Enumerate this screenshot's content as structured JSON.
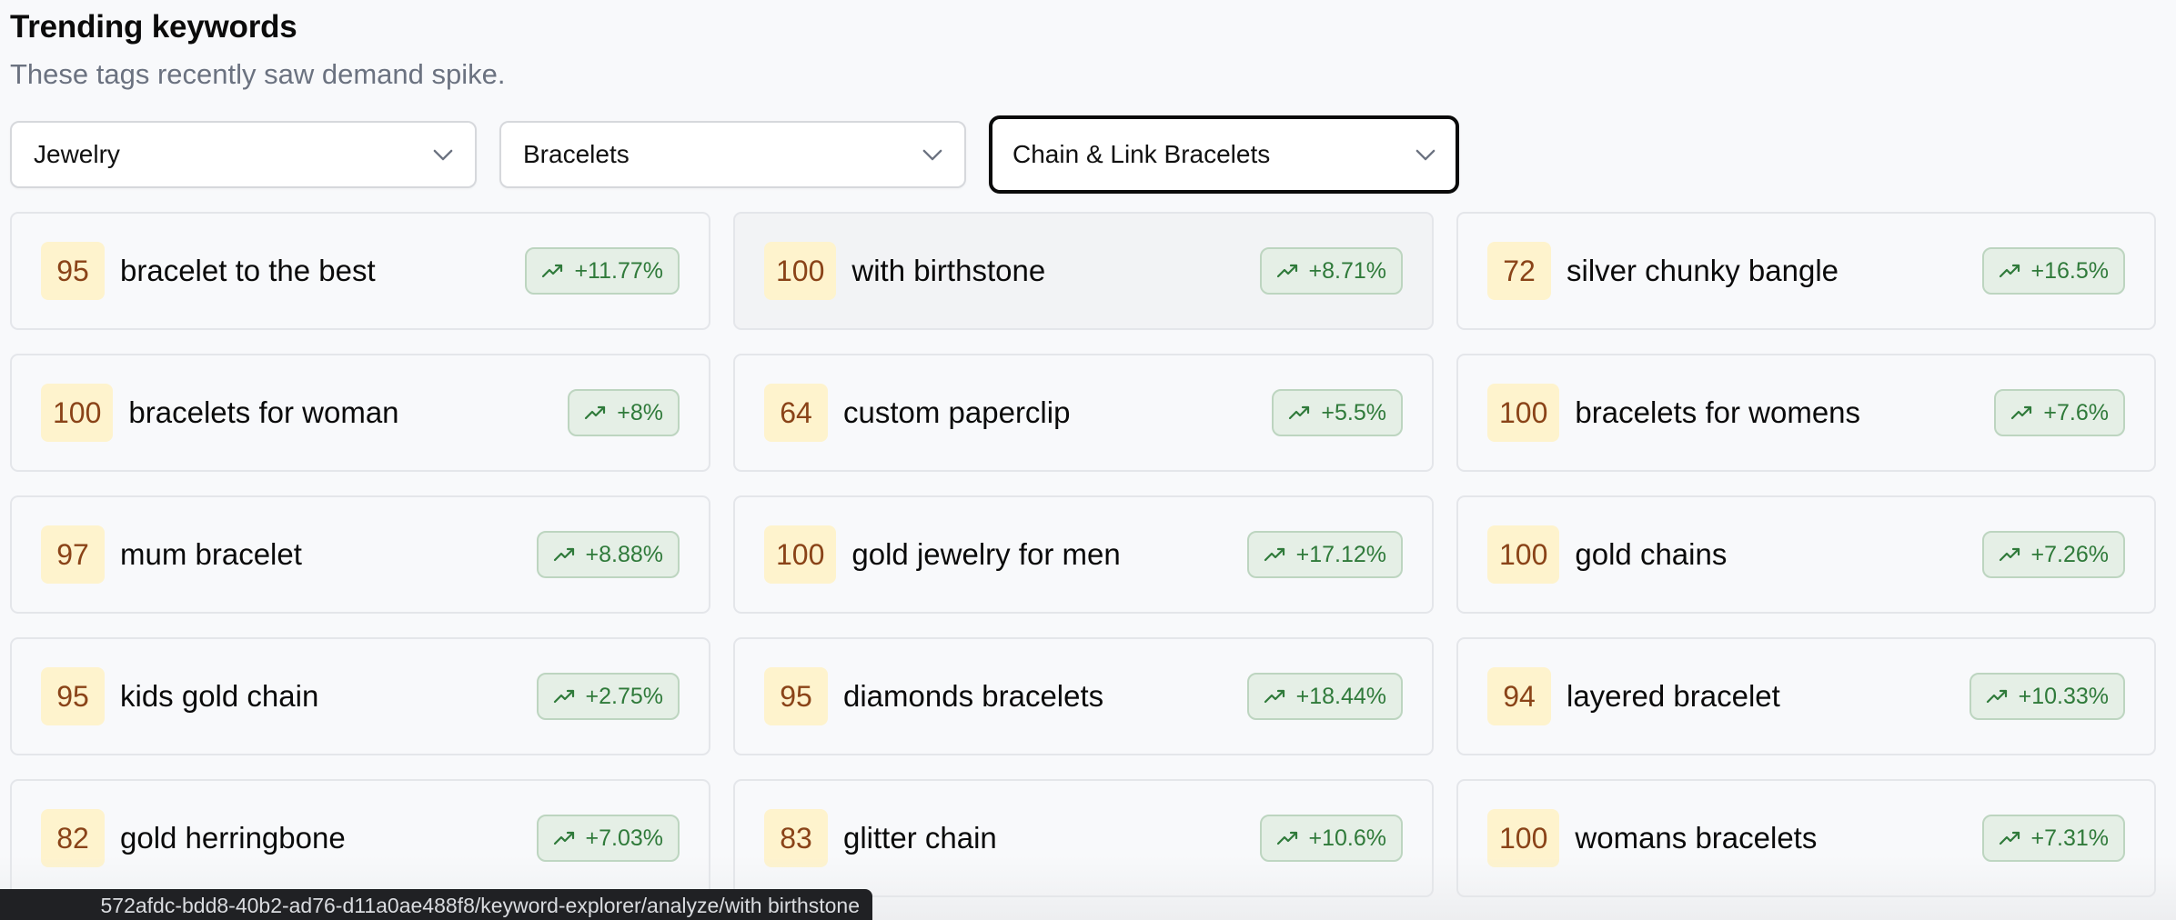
{
  "header": {
    "title": "Trending keywords",
    "subtitle": "These tags recently saw demand spike."
  },
  "filters": {
    "category": {
      "value": "Jewelry"
    },
    "subcategory": {
      "value": "Bracelets"
    },
    "type": {
      "value": "Chain & Link Bracelets",
      "focused": true
    }
  },
  "keywords": [
    {
      "score": "95",
      "keyword": "bracelet to the best",
      "trend": "+11.77%",
      "trend_icon": "trending-up-icon"
    },
    {
      "score": "100",
      "keyword": "with birthstone",
      "trend": "+8.71%",
      "trend_icon": "trending-up-icon",
      "hovered": true
    },
    {
      "score": "72",
      "keyword": "silver chunky bangle",
      "trend": "+16.5%",
      "trend_icon": "trending-up-icon"
    },
    {
      "score": "100",
      "keyword": "bracelets for woman",
      "trend": "+8%",
      "trend_icon": "trending-up-icon"
    },
    {
      "score": "64",
      "keyword": "custom paperclip",
      "trend": "+5.5%",
      "trend_icon": "trending-up-icon"
    },
    {
      "score": "100",
      "keyword": "bracelets for womens",
      "trend": "+7.6%",
      "trend_icon": "trending-up-icon"
    },
    {
      "score": "97",
      "keyword": "mum bracelet",
      "trend": "+8.88%",
      "trend_icon": "trending-up-icon"
    },
    {
      "score": "100",
      "keyword": "gold jewelry for men",
      "trend": "+17.12%",
      "trend_icon": "trending-up-icon"
    },
    {
      "score": "100",
      "keyword": "gold chains",
      "trend": "+7.26%",
      "trend_icon": "trending-up-icon"
    },
    {
      "score": "95",
      "keyword": "kids gold chain",
      "trend": "+2.75%",
      "trend_icon": "trending-up-icon"
    },
    {
      "score": "95",
      "keyword": "diamonds bracelets",
      "trend": "+18.44%",
      "trend_icon": "trending-up-icon"
    },
    {
      "score": "94",
      "keyword": "layered bracelet",
      "trend": "+10.33%",
      "trend_icon": "trending-up-icon"
    },
    {
      "score": "82",
      "keyword": "gold herringbone",
      "trend": "+7.03%",
      "trend_icon": "trending-up-icon"
    },
    {
      "score": "83",
      "keyword": "glitter chain",
      "trend": "+10.6%",
      "trend_icon": "trending-up-icon"
    },
    {
      "score": "100",
      "keyword": "womans bracelets",
      "trend": "+7.31%",
      "trend_icon": "trending-up-icon"
    }
  ],
  "status_bar": {
    "url": "572afdc-bdd8-40b2-ad76-d11a0ae488f8/keyword-explorer/analyze/with birthstone"
  },
  "colors": {
    "score_bg": "#FEF3CD",
    "score_text": "#8A4318",
    "trend_bg": "#E5EFE6",
    "trend_border": "#BDD5C0",
    "trend_text": "#2F7A3A",
    "focus_border": "#0A0A0A"
  }
}
